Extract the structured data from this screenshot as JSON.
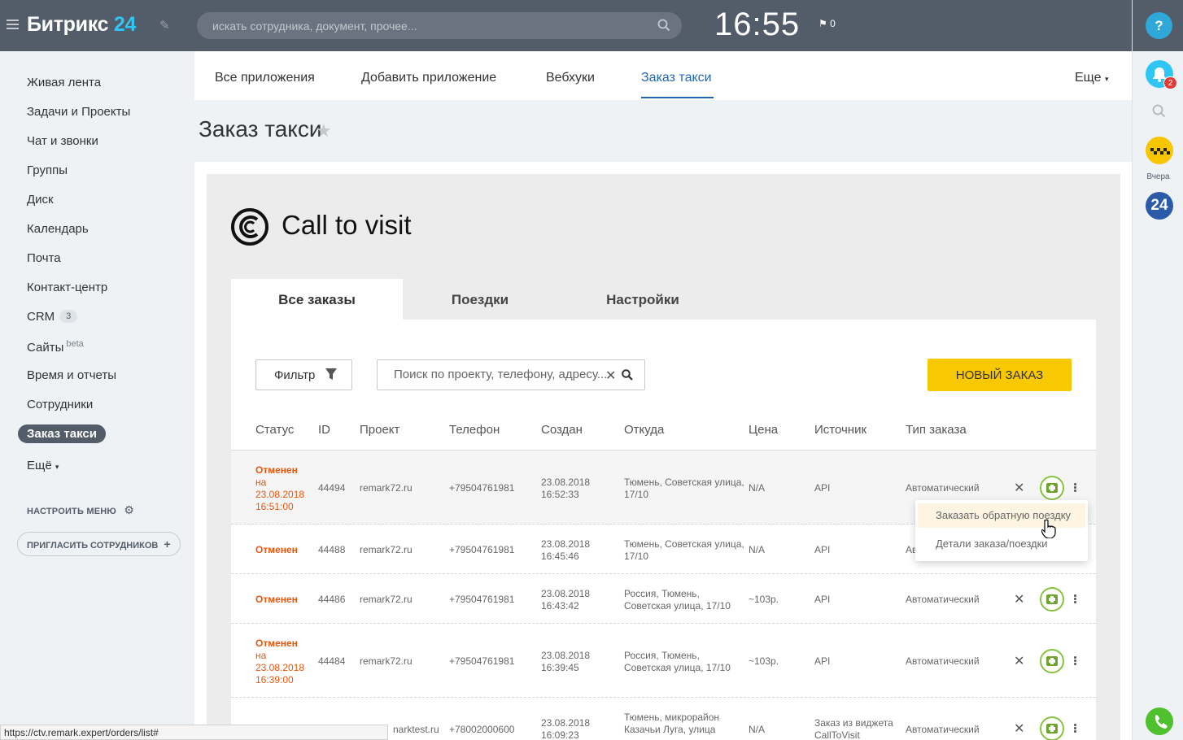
{
  "header": {
    "logo_text": "Битрикс",
    "logo_num": "24",
    "search_placeholder": "искать сотрудника, документ, прочее...",
    "clock": "16:55",
    "flag_count": "0"
  },
  "right_panel": {
    "help": "?",
    "bell_badge": "2",
    "taxi_label": "Вчера",
    "b24": "24"
  },
  "left_menu": {
    "items": [
      {
        "label": "Живая лента"
      },
      {
        "label": "Задачи и Проекты"
      },
      {
        "label": "Чат и звонки"
      },
      {
        "label": "Группы"
      },
      {
        "label": "Диск"
      },
      {
        "label": "Календарь"
      },
      {
        "label": "Почта"
      },
      {
        "label": "Контакт-центр"
      },
      {
        "label": "CRM",
        "counter": "3"
      },
      {
        "label": "Сайты",
        "sup": "beta"
      },
      {
        "label": "Время и отчеты"
      },
      {
        "label": "Сотрудники"
      },
      {
        "label": "Заказ такси"
      },
      {
        "label": "Ещё"
      }
    ],
    "configure": "НАСТРОИТЬ МЕНЮ",
    "invite": "ПРИГЛАСИТЬ СОТРУДНИКОВ"
  },
  "top_tabs": [
    "Все приложения",
    "Добавить приложение",
    "Вебхуки",
    "Заказ такси"
  ],
  "more": "Еще",
  "page_title": "Заказ такси",
  "app": {
    "title": "Call to visit",
    "tabs": [
      "Все заказы",
      "Поездки",
      "Настройки"
    ],
    "filter_label": "Фильтр",
    "search_placeholder": "Поиск по проекту, телефону, адресу...",
    "new_order": "НОВЫЙ ЗАКАЗ",
    "columns": [
      "Статус",
      "ID",
      "Проект",
      "Телефон",
      "Создан",
      "Откуда",
      "Цена",
      "Источник",
      "Тип заказа"
    ],
    "rows": [
      {
        "status": "Отменен",
        "status_sub": [
          "на",
          "23.08.2018",
          "16:51:00"
        ],
        "id": "44494",
        "project": "remark72.ru",
        "phone": "+79504761981",
        "created": [
          "23.08.2018",
          "16:52:33"
        ],
        "from": [
          "Тюмень, Советская улица,",
          "17/10"
        ],
        "price": "N/A",
        "source": [
          "API"
        ],
        "type": "Автоматический"
      },
      {
        "status": "Отменен",
        "status_sub": [],
        "id": "44488",
        "project": "remark72.ru",
        "phone": "+79504761981",
        "created": [
          "23.08.2018",
          "16:45:46"
        ],
        "from": [
          "Тюмень, Советская улица,",
          "17/10"
        ],
        "price": "N/A",
        "source": [
          "API"
        ],
        "type": "Ав"
      },
      {
        "status": "Отменен",
        "status_sub": [],
        "id": "44486",
        "project": "remark72.ru",
        "phone": "+79504761981",
        "created": [
          "23.08.2018",
          "16:43:42"
        ],
        "from": [
          "Россия, Тюмень,",
          "Советская улица, 17/10"
        ],
        "price": "~103р.",
        "source": [
          "API"
        ],
        "type": "Автоматический"
      },
      {
        "status": "Отменен",
        "status_sub": [
          "на",
          "23.08.2018",
          "16:39:00"
        ],
        "id": "44484",
        "project": "remark72.ru",
        "phone": "+79504761981",
        "created": [
          "23.08.2018",
          "16:39:45"
        ],
        "from": [
          "Россия, Тюмень,",
          "Советская улица, 17/10"
        ],
        "price": "~103р.",
        "source": [
          "API"
        ],
        "type": "Автоматический"
      },
      {
        "status": "",
        "status_sub": [],
        "id": "",
        "project": "narktest.ru",
        "phone": "+78002000600",
        "created": [
          "23.08.2018",
          "16:09:23"
        ],
        "from": [
          "Тюмень, микрорайон",
          "Казачьи Луга, улица"
        ],
        "price": "N/A",
        "source": [
          "Заказ из виджета",
          "CallToVisit"
        ],
        "type": "Автоматический"
      }
    ],
    "dropdown": [
      "Заказать обратную поездку",
      "Детали заказа/поездки"
    ]
  },
  "statusbar_url": "https://ctv.remark.expert/orders/list#"
}
